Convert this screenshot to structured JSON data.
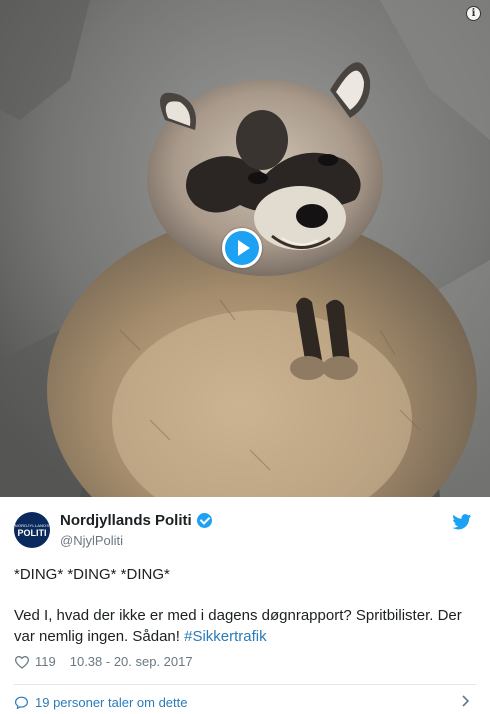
{
  "media": {
    "subject_icon": "raccoon-image",
    "play_icon": "play-icon",
    "info_symbol": "i"
  },
  "author": {
    "avatar_text_small": "NORDJYLLANDS",
    "avatar_text_big": "POLITI",
    "name": "Nordjyllands Politi",
    "handle": "@NjylPoliti",
    "verified_icon": "verified-badge-icon",
    "brand_icon": "twitter-bird-icon"
  },
  "tweet": {
    "line1": "*DING* *DING* *DING*",
    "line2": "Ved I, hvad der ikke er med i dagens døgnrapport? Spritbilister. Der var nemlig ingen. Sådan! ",
    "hashtag": "#Sikkertrafik"
  },
  "meta": {
    "likes": "119",
    "timestamp": "10.38 - 20. sep. 2017"
  },
  "footer": {
    "label": "19 personer taler om dette"
  },
  "colors": {
    "accent": "#1da1f2",
    "link": "#2b7bb9",
    "muted": "#697882",
    "text": "#1c2022",
    "divider": "#e1e8ed"
  }
}
